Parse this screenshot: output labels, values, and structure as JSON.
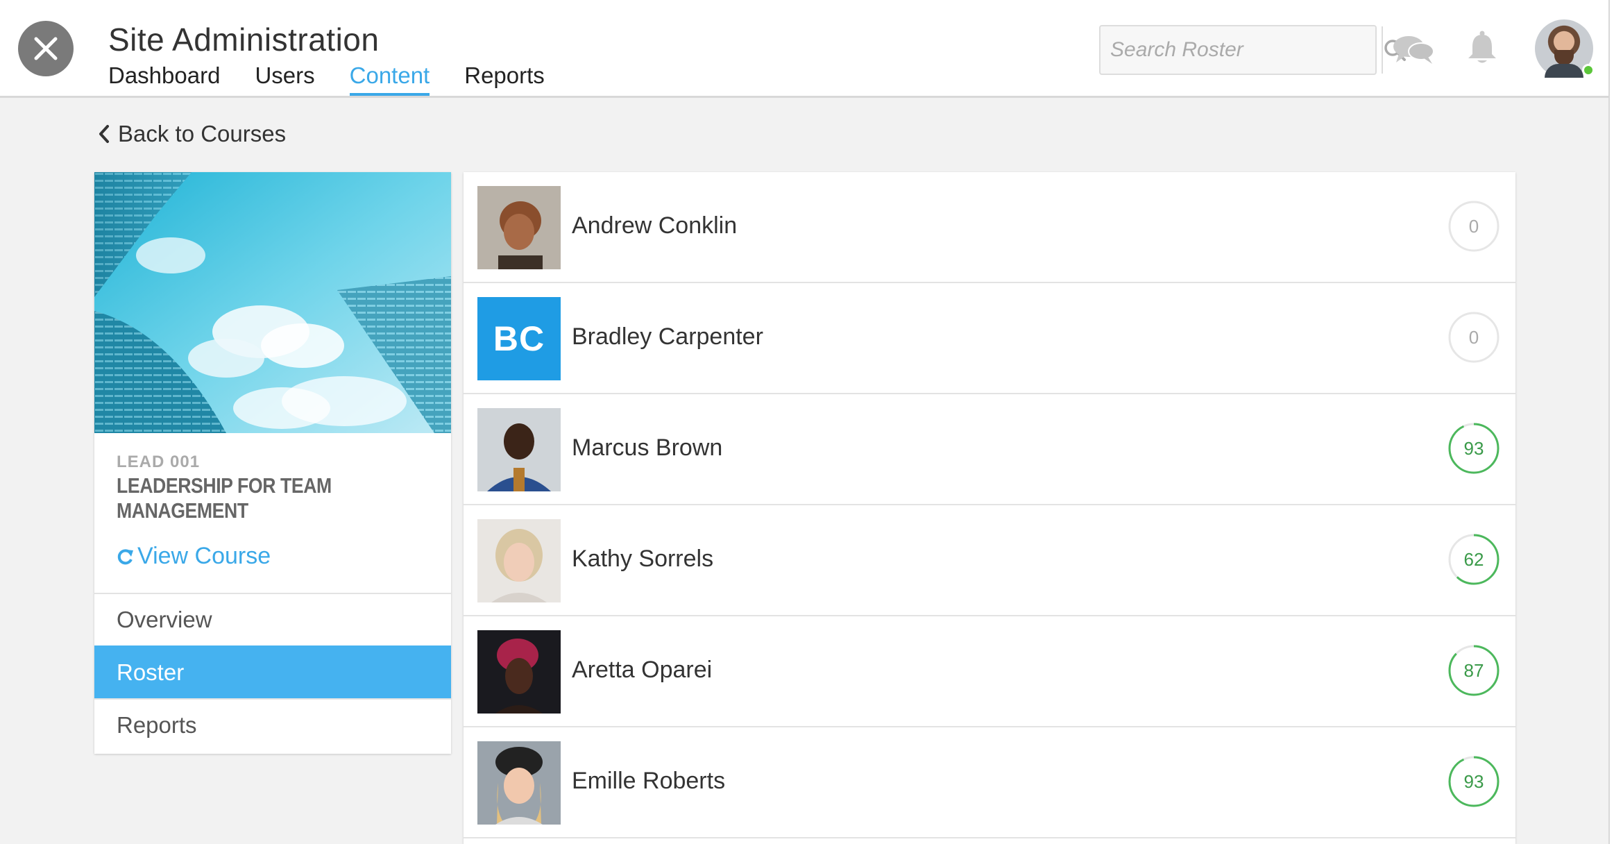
{
  "header": {
    "title": "Site Administration",
    "tabs": [
      {
        "label": "Dashboard"
      },
      {
        "label": "Users"
      },
      {
        "label": "Content"
      },
      {
        "label": "Reports"
      }
    ],
    "active_tab": "Content",
    "search": {
      "placeholder": "Search Roster",
      "value": ""
    },
    "icons": [
      "close-icon",
      "search-icon",
      "chat-icon",
      "bell-icon"
    ],
    "user_status": "online"
  },
  "back_link": {
    "label": "Back to Courses"
  },
  "course": {
    "code": "LEAD 001",
    "title": "LEADERSHIP FOR TEAM MANAGEMENT",
    "view_label": "View Course",
    "menu": [
      {
        "label": "Overview"
      },
      {
        "label": "Roster"
      },
      {
        "label": "Reports"
      }
    ],
    "active_menu": "Roster"
  },
  "roster": [
    {
      "name": "Andrew Conklin",
      "score": "0",
      "progress": 0
    },
    {
      "name": "Bradley Carpenter",
      "initials": "BC",
      "score": "0",
      "progress": 0
    },
    {
      "name": "Marcus Brown",
      "score": "93",
      "progress": 93
    },
    {
      "name": "Kathy Sorrels",
      "score": "62",
      "progress": 62
    },
    {
      "name": "Aretta Oparei",
      "score": "87",
      "progress": 87
    },
    {
      "name": "Emille Roberts",
      "score": "93",
      "progress": 93
    }
  ],
  "colors": {
    "accent": "#3aa8e8",
    "active_menu_bg": "#45b2f0",
    "score_green": "#4cb85c",
    "score_gray": "#e6e6e6",
    "initials_bg": "#1f9ce4",
    "online": "#5cc63a"
  }
}
